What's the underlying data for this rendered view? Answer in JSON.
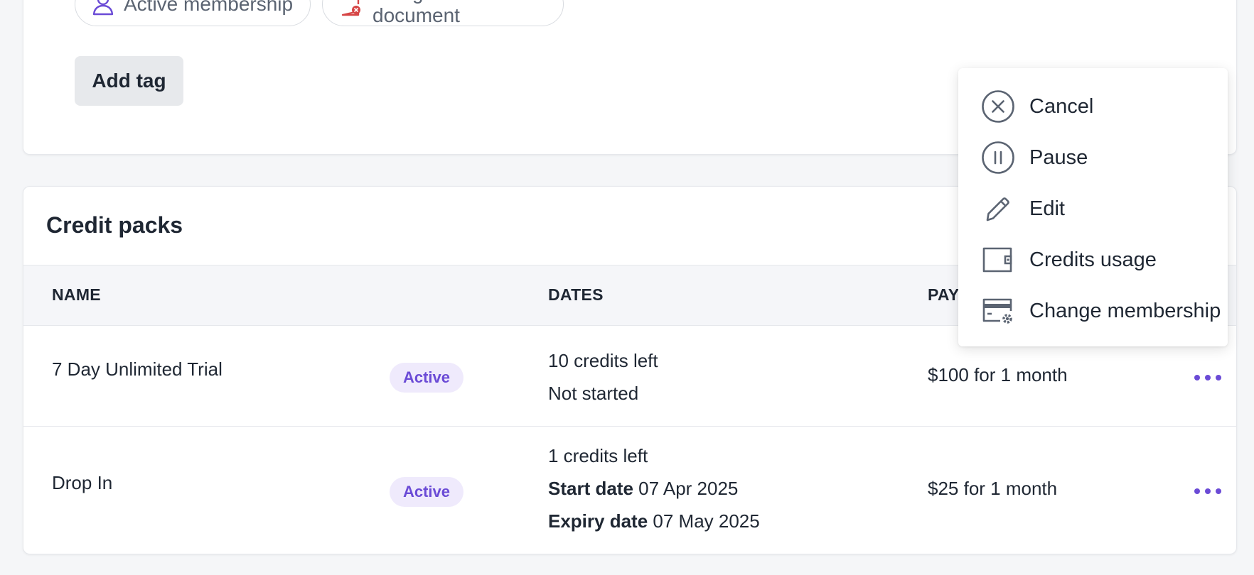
{
  "tags": {
    "chips": [
      {
        "label": "Active membership",
        "icon": "person-icon",
        "color": "#6b4bd6"
      },
      {
        "label": "Unsigned document",
        "icon": "document-x-icon",
        "color": "#d64545"
      }
    ],
    "add_tag_label": "Add tag"
  },
  "credit_packs": {
    "title": "Credit packs",
    "columns": [
      "NAME",
      "DATES",
      "PAY"
    ],
    "rows": [
      {
        "name": "7 Day Unlimited Trial",
        "status": "Active",
        "dates": {
          "credits": "10 credits left",
          "line2": "Not started"
        },
        "payment": "$100 for 1 month"
      },
      {
        "name": "Drop In",
        "status": "Active",
        "dates": {
          "credits": "1 credits left",
          "start_label": "Start date",
          "start_value": "07 Apr 2025",
          "expiry_label": "Expiry date",
          "expiry_value": "07 May 2025"
        },
        "payment": "$25 for 1 month"
      }
    ]
  },
  "context_menu": {
    "items": [
      {
        "label": "Cancel",
        "icon": "cancel-circle-icon"
      },
      {
        "label": "Pause",
        "icon": "pause-circle-icon"
      },
      {
        "label": "Edit",
        "icon": "pencil-icon"
      },
      {
        "label": "Credits usage",
        "icon": "wallet-icon"
      },
      {
        "label": "Change membership",
        "icon": "card-settings-icon"
      }
    ]
  },
  "colors": {
    "accent": "#6b4bd6",
    "danger": "#d64545",
    "icon": "#5b6472"
  }
}
